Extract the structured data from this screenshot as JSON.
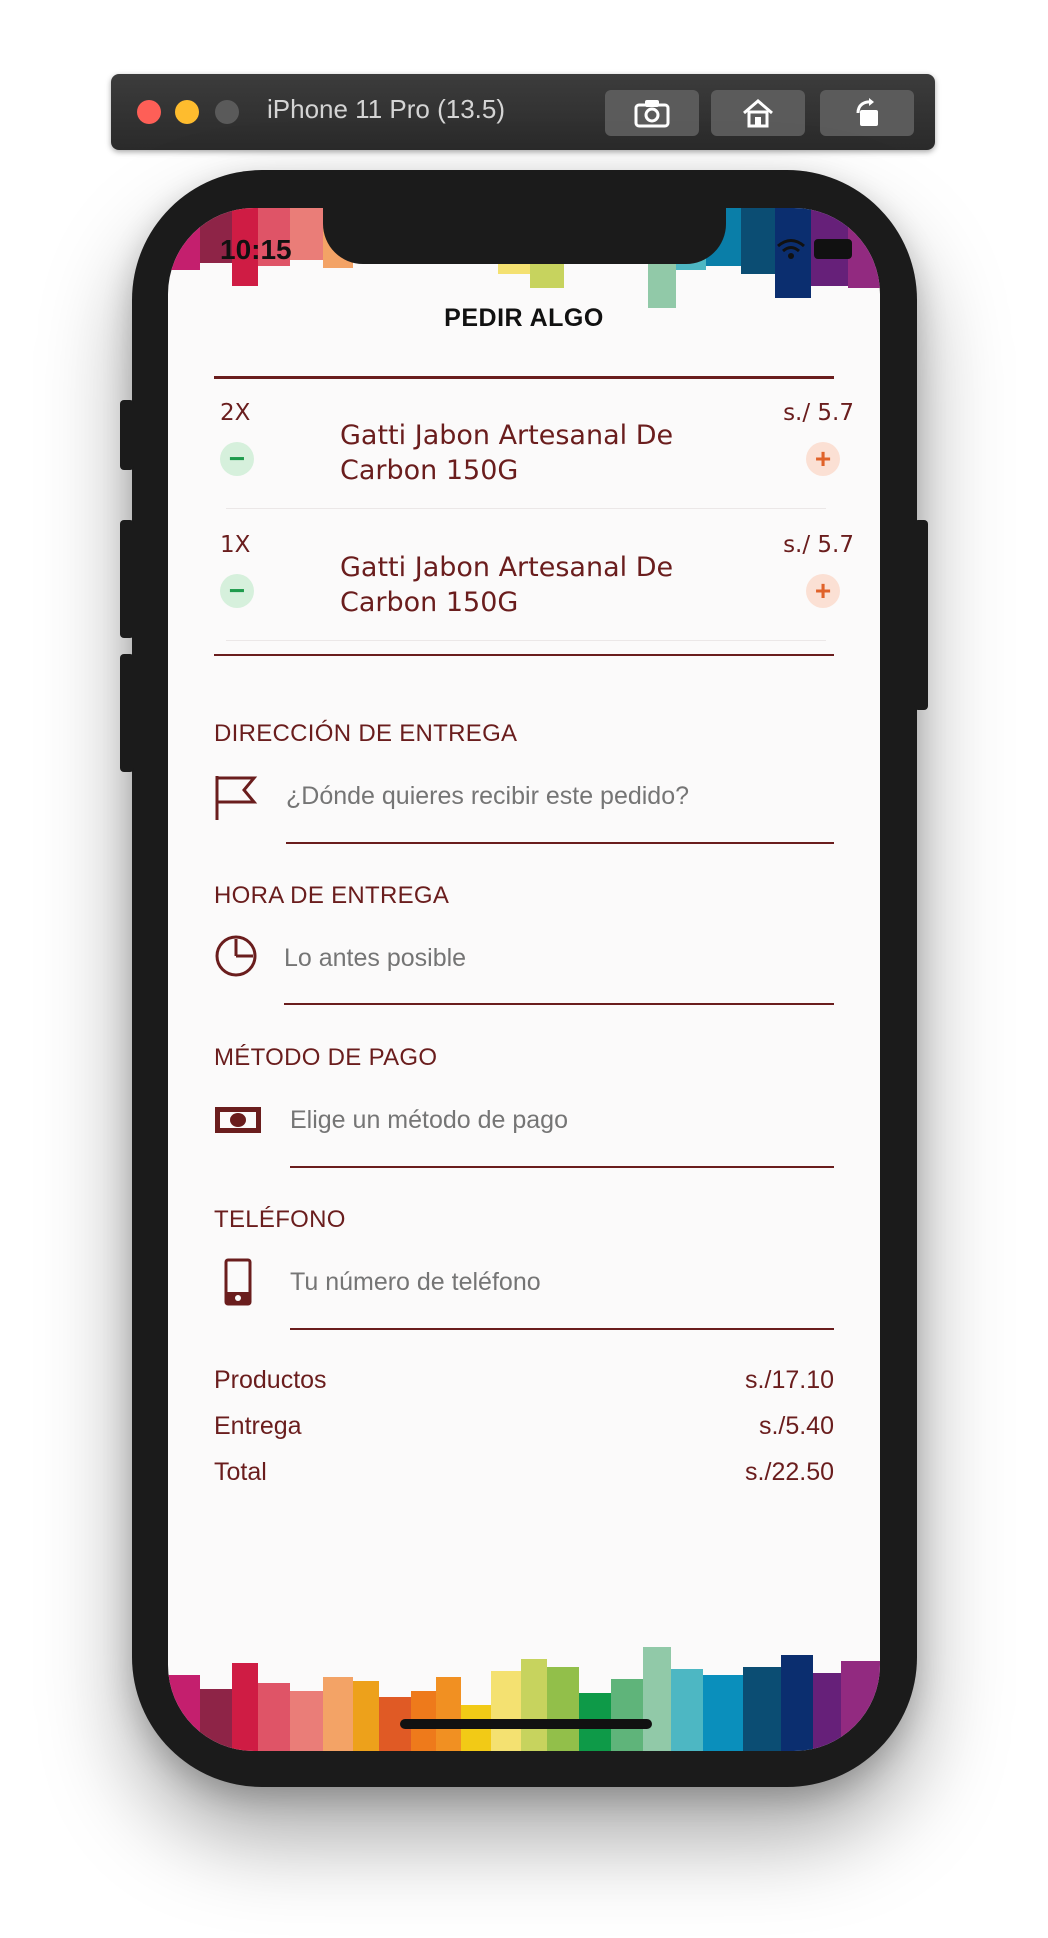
{
  "simulator": {
    "title": "iPhone 11 Pro (13.5)"
  },
  "status": {
    "time": "10:15"
  },
  "header": {
    "title": "PEDIR ALGO"
  },
  "items": [
    {
      "qty": "2X",
      "name": "Gatti Jabon Artesanal De Carbon 150G",
      "price": "s./ 5.7",
      "minus_icon": "minus",
      "plus_icon": "plus"
    },
    {
      "qty": "1X",
      "name": "Gatti Jabon Artesanal De Carbon 150G",
      "price": "s./ 5.7",
      "minus_icon": "minus",
      "plus_icon": "plus"
    }
  ],
  "form": {
    "address": {
      "label": "DIRECCIÓN DE ENTREGA",
      "placeholder": "¿Dónde quieres recibir este pedido?",
      "value": "",
      "icon": "flag-icon"
    },
    "time": {
      "label": "HORA DE ENTREGA",
      "placeholder": "Lo antes posible",
      "value": "",
      "icon": "clock-icon"
    },
    "payment": {
      "label": "MÉTODO DE PAGO",
      "placeholder": "Elige un método de pago",
      "value": "",
      "icon": "cash-icon"
    },
    "phone": {
      "label": "TELÉFONO",
      "placeholder": "Tu número de teléfono",
      "value": "",
      "icon": "phone-icon"
    }
  },
  "summary": {
    "products_label": "Productos",
    "products_value": "s./17.10",
    "delivery_label": "Entrega",
    "delivery_value": "s./5.40",
    "total_label": "Total",
    "total_value": "s./22.50"
  },
  "colors": {
    "accent": "#6a1d1d",
    "minus": "#1e9b4c",
    "plus": "#e0622a"
  }
}
